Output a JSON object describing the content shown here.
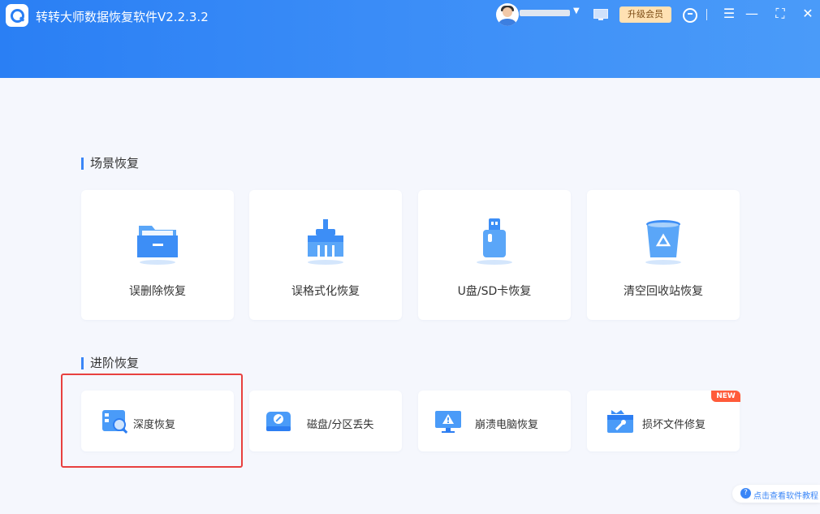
{
  "app": {
    "title": "转转大师数据恢复软件V2.2.3.2",
    "upgrade_label": "升级会员",
    "user_dropdown_glyph": "▼"
  },
  "window_controls": {
    "menu": "☰",
    "minimize": "—",
    "maximize": "⛶",
    "close": "✕"
  },
  "sections": {
    "scene": {
      "title": "场景恢复",
      "items": [
        {
          "label": "误删除恢复",
          "icon": "folder-icon"
        },
        {
          "label": "误格式化恢复",
          "icon": "broom-icon"
        },
        {
          "label": "U盘/SD卡恢复",
          "icon": "usb-drive-icon"
        },
        {
          "label": "清空回收站恢复",
          "icon": "recycle-bin-icon"
        }
      ]
    },
    "advanced": {
      "title": "进阶恢复",
      "items": [
        {
          "label": "深度恢复",
          "icon": "deep-scan-icon"
        },
        {
          "label": "磁盘/分区丢失",
          "icon": "disk-icon"
        },
        {
          "label": "崩溃电脑恢复",
          "icon": "crashed-computer-icon"
        },
        {
          "label": "损坏文件修复",
          "icon": "repair-file-icon",
          "badge": "NEW"
        }
      ]
    }
  },
  "help": {
    "icon_glyph": "?",
    "label": "点击查看软件教程"
  },
  "colors": {
    "accent": "#3a86f7",
    "header_start": "#2a7ff4",
    "header_end": "#4a9bf9",
    "highlight": "#e8403f",
    "badge": "#ff5b3a"
  }
}
